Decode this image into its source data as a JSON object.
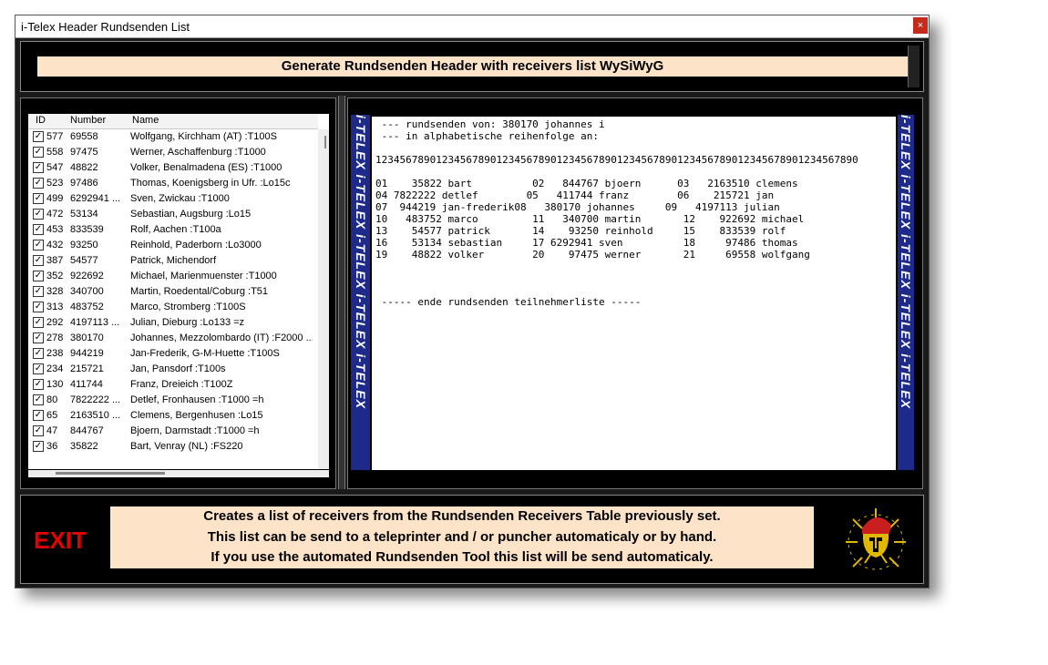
{
  "window": {
    "title": "i-Telex Header Rundsenden List",
    "close_glyph": "×"
  },
  "banner": {
    "text": "Generate Rundsenden Header with receivers list   WySiWyG"
  },
  "table": {
    "headers": [
      "ID",
      "Number",
      "Name"
    ],
    "rows": [
      {
        "id": "577",
        "number": "69558",
        "name": "Wolfgang, Kirchham (AT) :T100S"
      },
      {
        "id": "558",
        "number": "97475",
        "name": "Werner, Aschaffenburg :T1000"
      },
      {
        "id": "547",
        "number": "48822",
        "name": "Volker, Benalmadena (ES) :T1000"
      },
      {
        "id": "523",
        "number": "97486",
        "name": "Thomas, Koenigsberg in Ufr. :Lo15c"
      },
      {
        "id": "499",
        "number": "6292941 ...",
        "name": "Sven, Zwickau :T1000"
      },
      {
        "id": "472",
        "number": "53134",
        "name": "Sebastian, Augsburg :Lo15"
      },
      {
        "id": "453",
        "number": "833539",
        "name": "Rolf, Aachen :T100a"
      },
      {
        "id": "432",
        "number": "93250",
        "name": "Reinhold, Paderborn :Lo3000"
      },
      {
        "id": "387",
        "number": "54577",
        "name": "Patrick, Michendorf"
      },
      {
        "id": "352",
        "number": "922692",
        "name": "Michael, Marienmuenster :T1000"
      },
      {
        "id": "328",
        "number": "340700",
        "name": "Martin, Roedental/Coburg :T51"
      },
      {
        "id": "313",
        "number": "483752",
        "name": "Marco, Stromberg :T100S"
      },
      {
        "id": "292",
        "number": "4197113 ...",
        "name": "Julian, Dieburg :Lo133 =z"
      },
      {
        "id": "278",
        "number": "380170",
        "name": "Johannes, Mezzolombardo (IT) :F2000 ..."
      },
      {
        "id": "238",
        "number": "944219",
        "name": "Jan-Frederik, G-M-Huette :T100S"
      },
      {
        "id": "234",
        "number": "215721",
        "name": "Jan, Pansdorf :T100s"
      },
      {
        "id": "130",
        "number": "411744",
        "name": "Franz, Dreieich :T100Z"
      },
      {
        "id": "80",
        "number": "7822222 ...",
        "name": "Detlef, Fronhausen :T1000 =h"
      },
      {
        "id": "65",
        "number": "2163510 ...",
        "name": "Clemens, Bergenhusen :Lo15"
      },
      {
        "id": "47",
        "number": "844767",
        "name": "Bjoern, Darmstadt :T1000 =h"
      },
      {
        "id": "36",
        "number": "35822",
        "name": "Bart, Venray (NL) :FS220"
      }
    ]
  },
  "tape": {
    "text": "i-TELEX  i-TELEX  i-TELEX  i-TELEX  i-TELEX"
  },
  "preview": {
    "lines": [
      " --- rundsenden von: 380170 johannes i",
      " --- in alphabetische reihenfolge an:",
      "",
      "12345678901234567890123456789012345678901234567890123456789012345678901234567890",
      "",
      "01    35822 bart          02   844767 bjoern      03   2163510 clemens",
      "04 7822222 detlef        05   411744 franz        06    215721 jan",
      "07  944219 jan-frederik08   380170 johannes     09   4197113 julian",
      "10   483752 marco         11   340700 martin       12    922692 michael",
      "13    54577 patrick       14    93250 reinhold     15    833539 rolf",
      "16    53134 sebastian     17 6292941 sven          18     97486 thomas",
      "19    48822 volker        20    97475 werner       21     69558 wolfgang",
      "",
      "",
      "",
      " ----- ende rundsenden teilnehmerliste -----"
    ]
  },
  "exit": {
    "label": "EXIT"
  },
  "info": {
    "line1": "Creates a list of receivers from the Rundsenden Receivers Table previously set.",
    "line2": "This list can be send to a teleprinter and / or puncher automaticaly or by hand.",
    "line3": "If you use the automated Rundsenden Tool this list will be send automaticaly."
  },
  "colors": {
    "banner_bg": "#fde3c8",
    "exit_red": "#e40000",
    "tape_blue": "#1d2a8a"
  }
}
